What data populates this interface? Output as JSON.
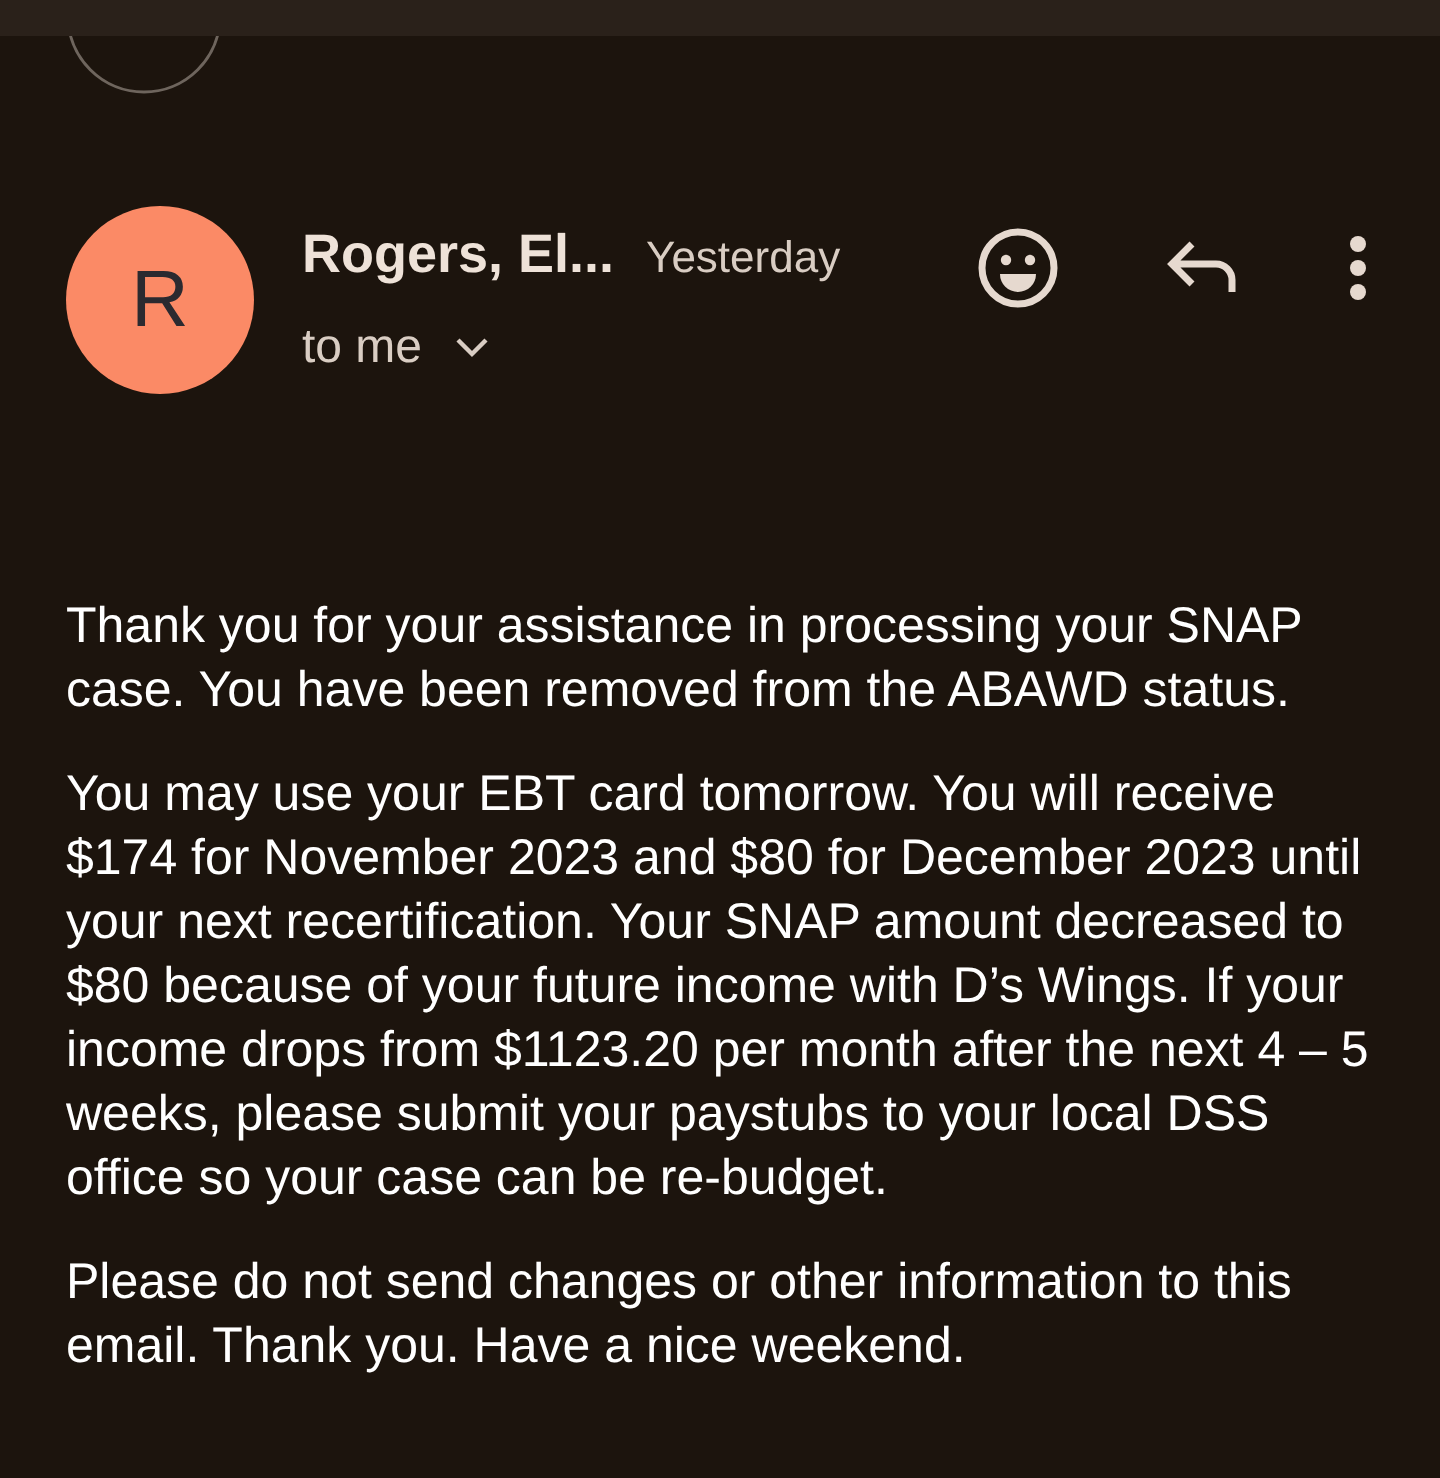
{
  "message": {
    "avatar_letter": "R",
    "sender": "Rogers, El...",
    "time": "Yesterday",
    "recipient": "to me"
  },
  "body": [
    "Thank you for your assistance in processing your SNAP case. You have been removed from the ABAWD status.",
    "You may use your EBT card tomorrow. You will receive $174 for November 2023 and $80 for December 2023 until your next recertification. Your SNAP amount decreased to $80 because of your future income with D’s Wings. If your income drops from $1123.20 per month after the next 4 – 5 weeks,  please submit your paystubs to your local DSS office so your case can be re-budget.",
    "Please do not send changes or other information to this email. Thank you. Have a nice weekend."
  ]
}
